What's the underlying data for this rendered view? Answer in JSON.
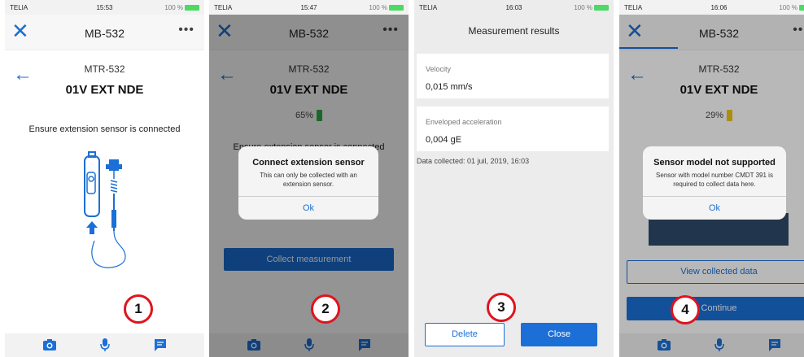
{
  "colors": {
    "accent": "#1b6fd6",
    "badge_ring": "#e0141e",
    "battery_green": "#2fb34a",
    "battery_yellow": "#f0c419"
  },
  "screens": [
    {
      "status": {
        "carrier": "TELIA",
        "time": "15:53",
        "right": "100 %"
      },
      "nav": {
        "title": "MB-532",
        "more": "•••"
      },
      "device": "MTR-532",
      "point": "01V EXT NDE",
      "instruction": "Ensure extension sensor is connected",
      "badge": "1"
    },
    {
      "status": {
        "carrier": "TELIA",
        "time": "15:47",
        "right": "100 %"
      },
      "nav": {
        "title": "MB-532",
        "more": "•••"
      },
      "device": "MTR-532",
      "point": "01V EXT NDE",
      "battery": "65%",
      "instruction": "Ensure extension sensor is connected",
      "alert": {
        "title": "Connect extension sensor",
        "message": "This can only be collected with an extension sensor.",
        "button": "Ok"
      },
      "collect_button": "Collect measurement",
      "badge": "2"
    },
    {
      "status": {
        "carrier": "TELIA",
        "time": "16:03",
        "right": "100 %"
      },
      "title": "Measurement results",
      "cards": [
        {
          "label": "Velocity",
          "value": "0,015 mm/s"
        },
        {
          "label": "Enveloped acceleration",
          "value": "0,004 gE"
        }
      ],
      "collected": "Data collected: 01 juil, 2019, 16:03",
      "delete_button": "Delete",
      "close_button": "Close",
      "badge": "3"
    },
    {
      "status": {
        "carrier": "TELIA",
        "time": "16:06",
        "right": "100 %"
      },
      "nav": {
        "title": "MB-532",
        "more": "•••"
      },
      "device": "MTR-532",
      "point": "01V EXT NDE",
      "battery": "29%",
      "alert": {
        "title": "Sensor model not supported",
        "message": "Sensor with model number CMDT 391 is required to collect data here.",
        "button": "Ok"
      },
      "view_button": "View collected data",
      "continue_button": "Continue",
      "badge": "4"
    }
  ]
}
